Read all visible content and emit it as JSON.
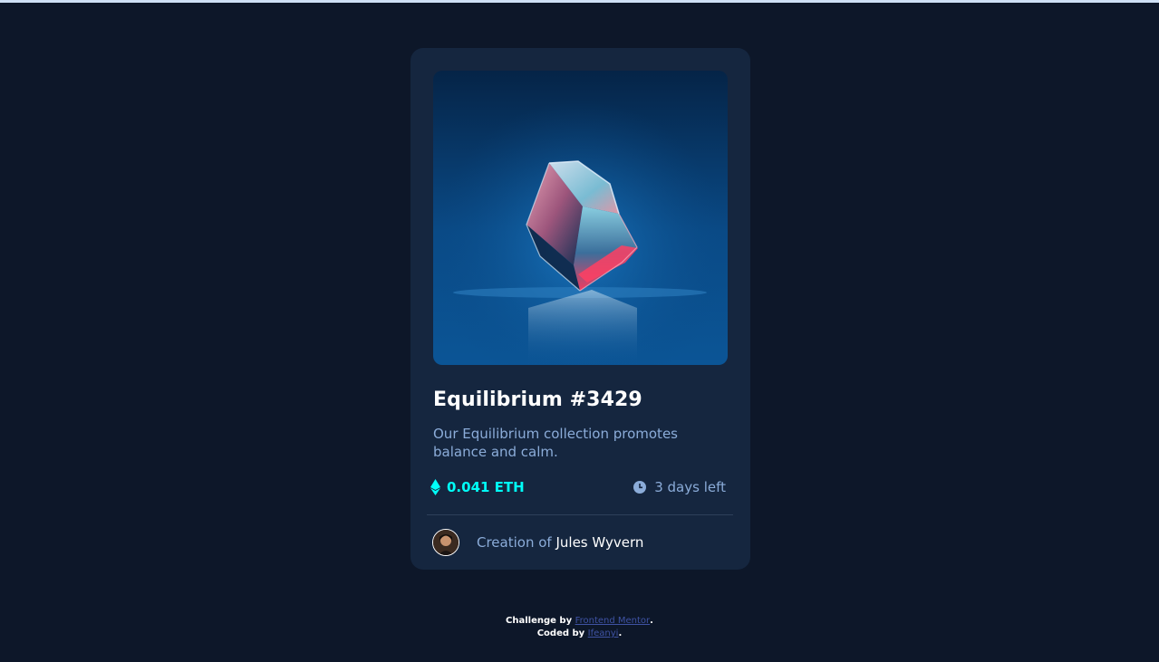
{
  "card": {
    "title": "Equilibrium #3429",
    "description": "Our Equilibrium collection promotes balance and calm.",
    "price": "0.041 ETH",
    "time_left": "3 days left",
    "creator_prefix": "Creation of",
    "creator_name": "Jules Wyvern"
  },
  "attribution": {
    "challenge_prefix": "Challenge by",
    "challenge_link": "Frontend Mentor",
    "challenge_suffix": ".",
    "coded_prefix": "Coded by",
    "coded_link": "Ifeanyi",
    "coded_suffix": "."
  },
  "colors": {
    "page_bg": "#0d1729",
    "card_bg": "#15263f",
    "cyan": "#00fff8",
    "soft_blue": "#8bacd9",
    "white": "#ffffff"
  },
  "icons": {
    "price": "ethereum-icon",
    "time": "clock-icon"
  }
}
